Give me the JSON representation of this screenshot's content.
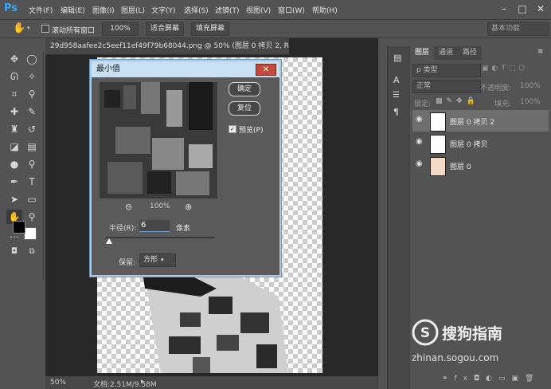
{
  "app": {
    "logo": "Ps",
    "menu": [
      "文件(F)",
      "编辑(E)",
      "图像(I)",
      "图层(L)",
      "文字(Y)",
      "选择(S)",
      "滤镜(T)",
      "视图(V)",
      "窗口(W)",
      "帮助(H)"
    ]
  },
  "window_controls": {
    "minimize": "–",
    "maximize": "□",
    "close": "✕"
  },
  "options_bar": {
    "scroll_all_label": "滚动所有窗口",
    "zoom_value": "100%",
    "fit_screen": "适合屏幕",
    "fill_screen": "填充屏幕",
    "workspace": "基本功能"
  },
  "document": {
    "tab_title": "29d958aafee2c5eef11ef49f79b68044.png @ 50% (图层 0 拷贝 2, RGB/8) *",
    "tab_close": "×",
    "zoom": "50%",
    "doc_info": "文档:2.51M/9.58M"
  },
  "dialog": {
    "title": "最小值",
    "ok_label": "确定",
    "reset_label": "复位",
    "preview_label": "预览(P)",
    "preview_checked": true,
    "zoom_out": "⊖",
    "zoom_in": "⊕",
    "zoom_percent": "100%",
    "radius_label": "半径(R):",
    "radius_value": "6",
    "radius_unit": "像素",
    "preserve_label": "保留:",
    "preserve_option": "方形"
  },
  "layers_panel": {
    "tabs": [
      "图层",
      "通道",
      "路径"
    ],
    "filter_kind": "ρ 类型",
    "blend_mode": "正常",
    "opacity_label": "不透明度:",
    "opacity_value": "100%",
    "lock_label": "锁定:",
    "fill_label": "填充:",
    "fill_value": "100%",
    "layers": [
      {
        "name": "图层 0 拷贝 2",
        "selected": true
      },
      {
        "name": "图层 0 拷贝",
        "selected": false
      },
      {
        "name": "图层 0",
        "selected": false
      }
    ]
  },
  "watermark": {
    "brand": "搜狗指南",
    "url": "zhinan.sogou.com"
  },
  "colors": {
    "accent": "#31a8ff",
    "dialog_border": "#a8c8e4",
    "close_red": "#c24a3b"
  }
}
